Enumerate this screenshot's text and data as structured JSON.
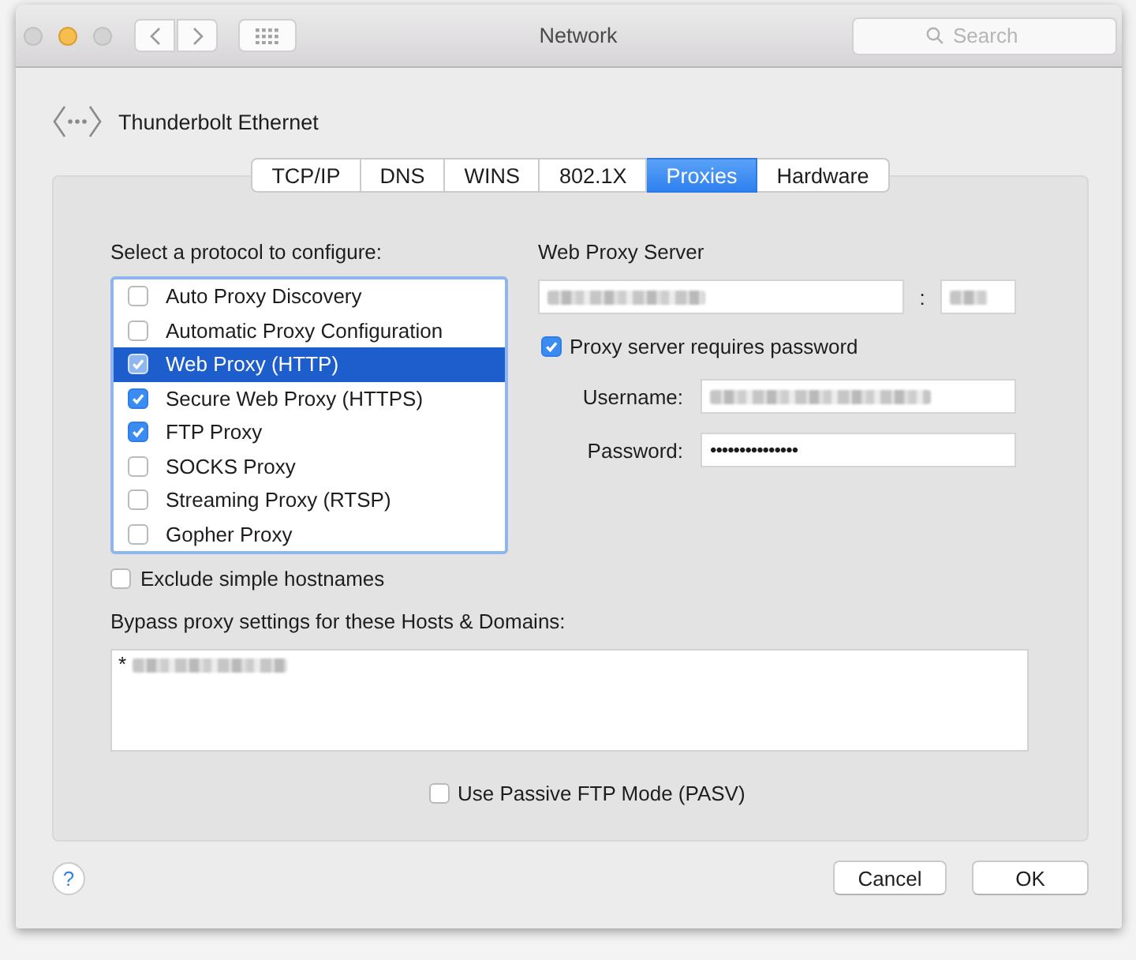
{
  "window": {
    "title": "Network",
    "controls": [
      {
        "kind": "close",
        "disabled": true
      },
      {
        "kind": "minimize",
        "disabled": false
      },
      {
        "kind": "zoom",
        "disabled": true
      }
    ]
  },
  "toolbar": {
    "search": {
      "placeholder": "Search"
    }
  },
  "interface": {
    "name": "Thunderbolt Ethernet"
  },
  "tabs": [
    {
      "label": "TCP/IP",
      "selected": false
    },
    {
      "label": "DNS",
      "selected": false
    },
    {
      "label": "WINS",
      "selected": false
    },
    {
      "label": "802.1X",
      "selected": false
    },
    {
      "label": "Proxies",
      "selected": true
    },
    {
      "label": "Hardware",
      "selected": false
    }
  ],
  "protocols": {
    "label": "Select a protocol to configure:",
    "items": [
      {
        "label": "Auto Proxy Discovery",
        "checked": false,
        "selected": false
      },
      {
        "label": "Automatic Proxy Configuration",
        "checked": false,
        "selected": false
      },
      {
        "label": "Web Proxy (HTTP)",
        "checked": true,
        "selected": true
      },
      {
        "label": "Secure Web Proxy (HTTPS)",
        "checked": true,
        "selected": false
      },
      {
        "label": "FTP Proxy",
        "checked": true,
        "selected": false
      },
      {
        "label": "SOCKS Proxy",
        "checked": false,
        "selected": false
      },
      {
        "label": "Streaming Proxy (RTSP)",
        "checked": false,
        "selected": false
      },
      {
        "label": "Gopher Proxy",
        "checked": false,
        "selected": false
      }
    ]
  },
  "exclude_simple_hostnames": {
    "label": "Exclude simple hostnames",
    "checked": false
  },
  "proxy_server": {
    "title": "Web Proxy Server",
    "host": {
      "redacted": true
    },
    "separator": ":",
    "port": {
      "redacted": true
    },
    "requires_password": {
      "label": "Proxy server requires password",
      "checked": true
    },
    "username": {
      "label": "Username:",
      "redacted": true
    },
    "password": {
      "label": "Password:",
      "value": "•••••••••••••••"
    }
  },
  "bypass": {
    "label": "Bypass proxy settings for these Hosts & Domains:",
    "value": "*",
    "redacted": true
  },
  "passive_ftp": {
    "label": "Use Passive FTP Mode (PASV)",
    "checked": false
  },
  "help_button": {
    "label": "?"
  },
  "buttons": [
    {
      "label": "Cancel"
    },
    {
      "label": "OK"
    }
  ]
}
